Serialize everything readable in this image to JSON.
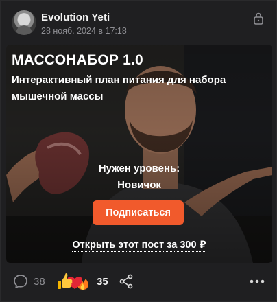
{
  "post": {
    "author": "Evolution Yeti",
    "date": "28 нояб. 2024 в 17:18",
    "title": "МАССОНАБОР 1.0",
    "subtitle": "Интерактивный план питания для набора мышечной массы",
    "level_label": "Нужен уровень:",
    "level_value": "Новичок",
    "subscribe_label": "Подписаться",
    "unlock_label": "Открыть этот пост за 300 ₽"
  },
  "footer": {
    "comments_count": "38",
    "reactions_count": "35",
    "reaction_icons": [
      "thumbs-up-icon",
      "heart-icon",
      "fire-icon"
    ]
  },
  "colors": {
    "accent": "#f15a2c",
    "background": "#1f1f21",
    "muted_text": "#8e8e93"
  }
}
